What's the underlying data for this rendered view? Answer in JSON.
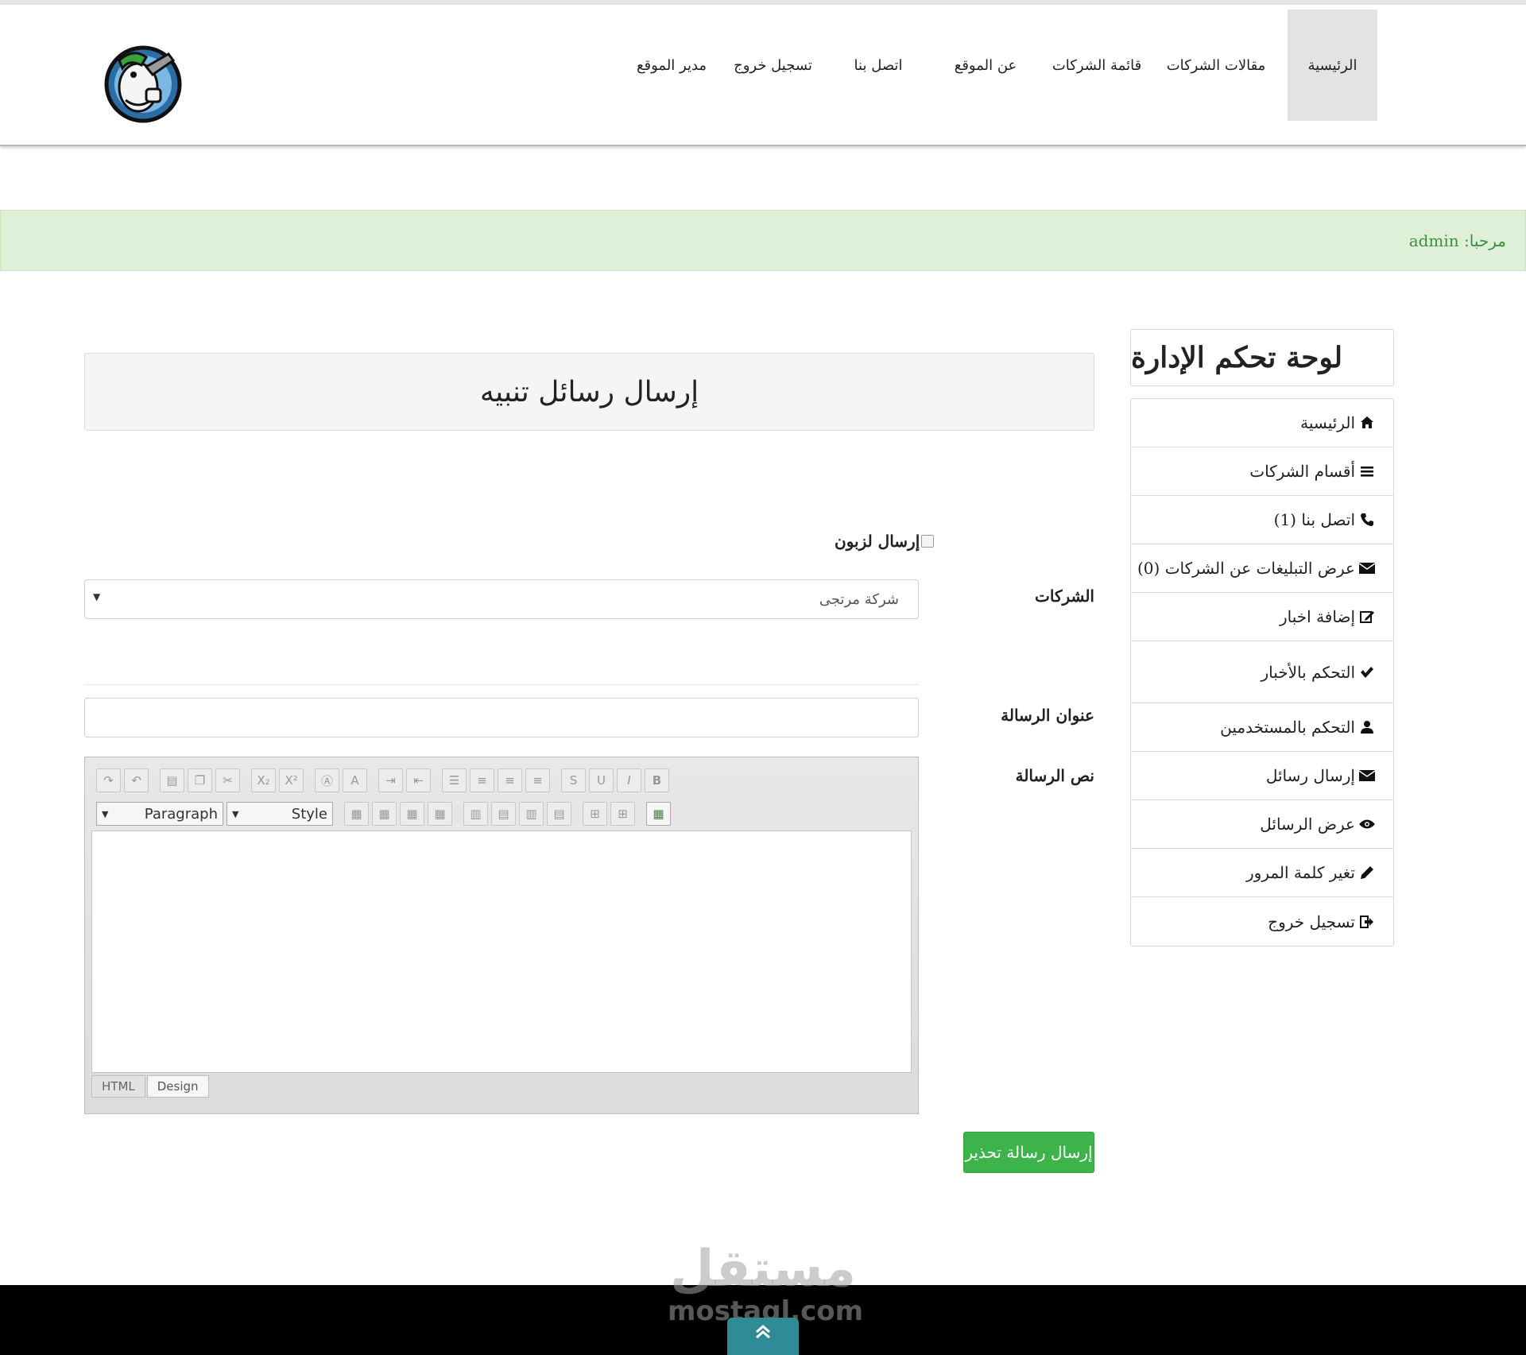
{
  "navbar": {
    "items": [
      {
        "label": "الرئيسية",
        "active": true
      },
      {
        "label": "مقالات الشركات"
      },
      {
        "label": "قائمة الشركات"
      },
      {
        "label": "عن الموقع"
      },
      {
        "label": "اتصل بنا"
      },
      {
        "label": "تسجيل خروج"
      },
      {
        "label": "مدير الموقع"
      }
    ],
    "logo_icon": "mechanic-mascot-logo"
  },
  "welcome": {
    "text": "مرحبا: admin"
  },
  "sidebar": {
    "title": "لوحة تحكم الإدارة",
    "items": [
      {
        "label": "الرئيسية",
        "icon": "home-icon"
      },
      {
        "label": "أقسام الشركات",
        "icon": "list-icon"
      },
      {
        "label": "اتصل بنا (1)",
        "icon": "phone-icon"
      },
      {
        "label": "عرض التبليغات عن الشركات (0)",
        "icon": "envelope-icon"
      },
      {
        "label": "إضافة اخبار",
        "icon": "edit-icon"
      },
      {
        "label": "التحكم بالأخبار",
        "icon": "check-icon"
      },
      {
        "label": "التحكم بالمستخدمين",
        "icon": "user-icon"
      },
      {
        "label": "إرسال رسائل",
        "icon": "envelope-icon"
      },
      {
        "label": "عرض الرسائل",
        "icon": "eye-icon"
      },
      {
        "label": "تغير كلمة المرور",
        "icon": "pencil-icon"
      },
      {
        "label": "تسجيل خروج",
        "icon": "sign-out-icon"
      }
    ]
  },
  "main": {
    "header": "إرسال رسائل تنبيه",
    "send_customer_label": "إرسال لزبون",
    "send_customer_checked": false,
    "companies_label": "الشركات",
    "companies_selected": "شركة مرتجى",
    "subject_label": "عنوان الرسالة",
    "subject_value": "",
    "body_label": "نص الرسالة",
    "editor": {
      "paragraph_select": "Paragraph",
      "style_select": "Style",
      "tab_html": "HTML",
      "tab_design": "Design",
      "active_tab": "Design"
    },
    "submit_label": "إرسال رسالة تحذير"
  },
  "watermark": {
    "ar": "مستقل",
    "en": "mostaql.com"
  },
  "colors": {
    "success_green": "#3db44a",
    "alert_bg": "#dff0d8",
    "alert_text": "#3c8f3e",
    "footer_bg": "#000000",
    "to_top_bg": "#2f8b96"
  }
}
